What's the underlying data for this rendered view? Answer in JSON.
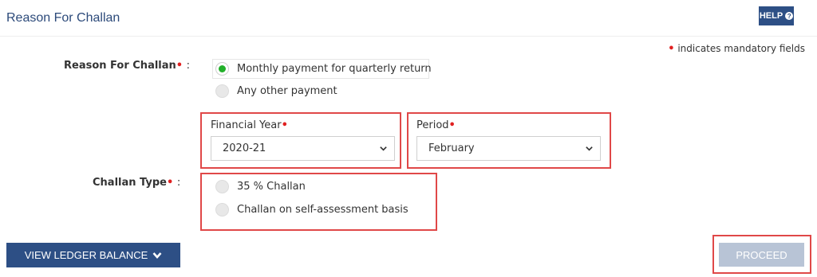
{
  "header": {
    "title": "Reason For Challan",
    "help_label": "HELP"
  },
  "mandatory_note": {
    "dot": "•",
    "text": "indicates mandatory fields"
  },
  "reason": {
    "label": "Reason For Challan",
    "req": "•",
    "colon": ":",
    "options": [
      {
        "label": "Monthly payment for quarterly return",
        "checked": true
      },
      {
        "label": "Any other payment",
        "checked": false
      }
    ]
  },
  "financial_year": {
    "label": "Financial Year",
    "req": "•",
    "value": "2020-21"
  },
  "period": {
    "label": "Period",
    "req": "•",
    "value": "February"
  },
  "challan_type": {
    "label": "Challan Type",
    "req": "•",
    "colon": ":",
    "options": [
      {
        "label": "35 % Challan",
        "checked": false
      },
      {
        "label": "Challan on self-assessment basis",
        "checked": false
      }
    ]
  },
  "actions": {
    "ledger_label": "VIEW LEDGER BALANCE",
    "proceed_label": "PROCEED"
  },
  "colors": {
    "primary": "#2d4f85",
    "title": "#2c4a7a",
    "required": "#e02020",
    "radio_selected": "#22b02a",
    "highlight_box": "#e04848",
    "disabled_button": "#b8c4d6"
  }
}
